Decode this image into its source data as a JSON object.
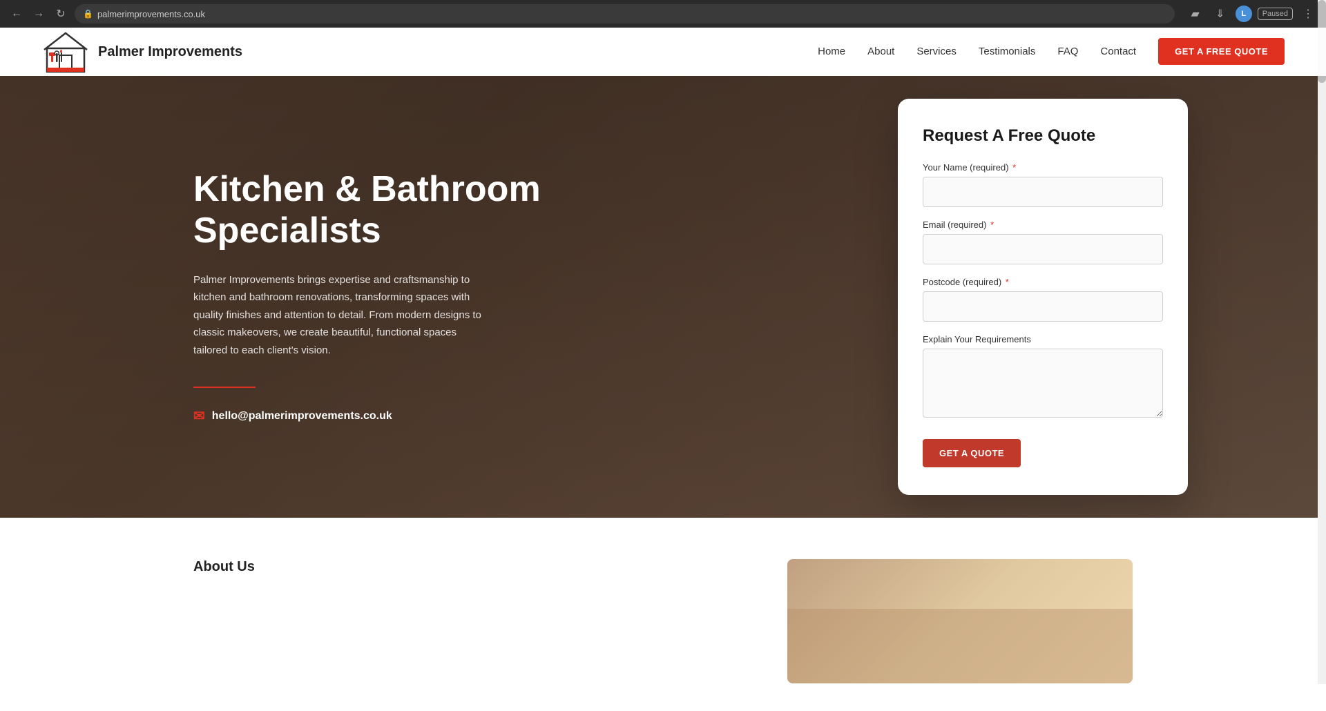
{
  "browser": {
    "url": "palmerimprovements.co.uk",
    "profile_initial": "L",
    "paused_label": "Paused"
  },
  "navbar": {
    "brand_name": "Palmer Improvements",
    "nav_items": [
      {
        "label": "Home",
        "id": "home"
      },
      {
        "label": "About",
        "id": "about"
      },
      {
        "label": "Services",
        "id": "services"
      },
      {
        "label": "Testimonials",
        "id": "testimonials"
      },
      {
        "label": "FAQ",
        "id": "faq"
      },
      {
        "label": "Contact",
        "id": "contact"
      }
    ],
    "cta_label": "GET A FREE QUOTE"
  },
  "hero": {
    "title": "Kitchen & Bathroom Specialists",
    "description": "Palmer Improvements brings expertise and craftsmanship to kitchen and bathroom renovations, transforming spaces with quality finishes and attention to detail. From modern designs to classic makeovers, we create beautiful, functional spaces tailored to each client's vision.",
    "email": "hello@palmerimprovements.co.uk"
  },
  "quote_form": {
    "title": "Request A Free Quote",
    "name_label": "Your Name (required)",
    "name_required": "*",
    "email_label": "Email (required)",
    "email_required": "*",
    "postcode_label": "Postcode (required)",
    "postcode_required": "*",
    "requirements_label": "Explain Your Requirements",
    "submit_label": "GET A QUOTE"
  },
  "about_section": {
    "title": "About Us"
  }
}
